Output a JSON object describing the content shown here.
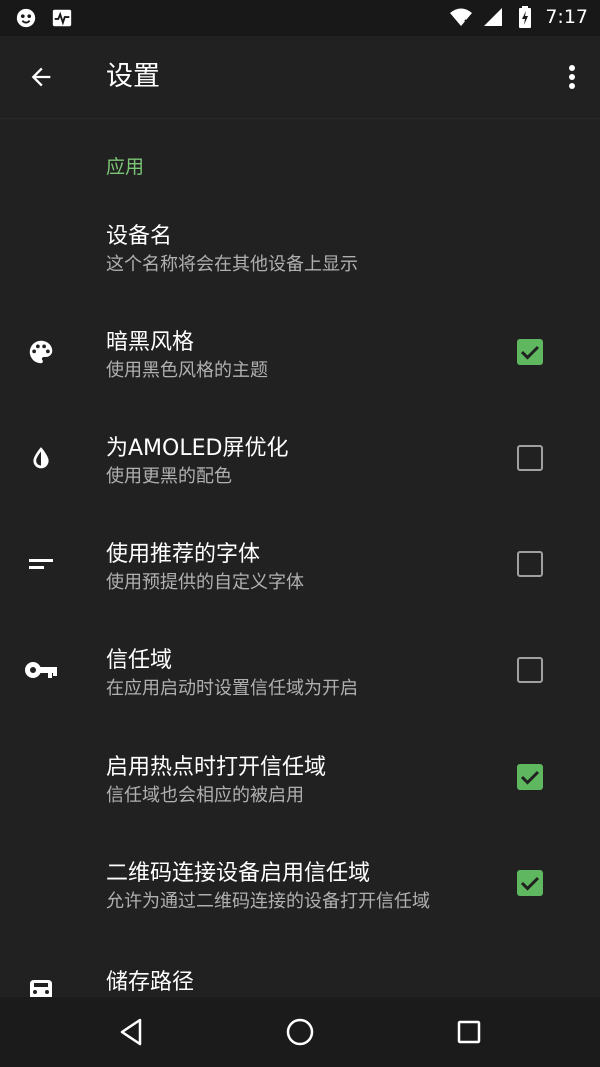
{
  "status_bar": {
    "time": "7:17"
  },
  "toolbar": {
    "title": "设置"
  },
  "section": {
    "header": "应用"
  },
  "prefs": [
    {
      "title": "设备名",
      "summary": "这个名称将会在其他设备上显示"
    },
    {
      "title": "暗黑风格",
      "summary": "使用黑色风格的主题",
      "checked": true,
      "icon": "palette-icon"
    },
    {
      "title": "为AMOLED屏优化",
      "summary": "使用更黑的配色",
      "checked": false,
      "icon": "water-drop-icon"
    },
    {
      "title": "使用推荐的字体",
      "summary": "使用预提供的自定义字体",
      "checked": false,
      "icon": "short-text-icon"
    },
    {
      "title": "信任域",
      "summary": "在应用启动时设置信任域为开启",
      "checked": false,
      "icon": "key-icon"
    },
    {
      "title": "启用热点时打开信任域",
      "summary": "信任域也会相应的被启用",
      "checked": true
    },
    {
      "title": "二维码连接设备启用信任域",
      "summary": "允许为通过二维码连接的设备打开信任域",
      "checked": true
    },
    {
      "title": "储存路径",
      "icon": "storage-icon"
    }
  ],
  "colors": {
    "accent": "#5fb85f",
    "section_header": "#7cc576",
    "background": "#212121"
  }
}
